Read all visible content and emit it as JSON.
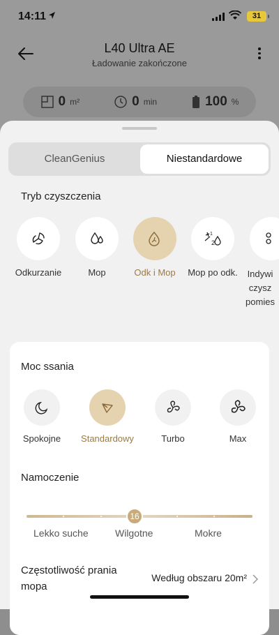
{
  "status_bar": {
    "time": "14:11",
    "battery": "31"
  },
  "header": {
    "title": "L40 Ultra AE",
    "subtitle": "Ładowanie zakończone"
  },
  "stats": [
    {
      "icon": "area-icon",
      "value": "0",
      "unit": "m²"
    },
    {
      "icon": "clock-icon",
      "value": "0",
      "unit": "min"
    },
    {
      "icon": "battery-icon",
      "value": "100",
      "unit": "%"
    }
  ],
  "tabs": {
    "left": "CleanGenius",
    "right": "Niestandardowe",
    "active": "right"
  },
  "cleaning_mode": {
    "title": "Tryb czyszczenia",
    "items": [
      {
        "label": "Odkurzanie",
        "selected": false
      },
      {
        "label": "Mop",
        "selected": false
      },
      {
        "label": "Odk i Mop",
        "selected": true
      },
      {
        "label": "Mop po odk.",
        "selected": false
      },
      {
        "label": "Indywidualne czyszczenie pomieszczeń",
        "selected": false
      }
    ],
    "partial_label_lines": [
      "Indywi",
      "czysz",
      "pomies"
    ]
  },
  "suction": {
    "title": "Moc ssania",
    "items": [
      {
        "label": "Spokojne",
        "selected": false
      },
      {
        "label": "Standardowy",
        "selected": true
      },
      {
        "label": "Turbo",
        "selected": false
      },
      {
        "label": "Max",
        "selected": false
      }
    ]
  },
  "moisture": {
    "title": "Namoczenie",
    "value": "16",
    "labels": [
      "Lekko suche",
      "Wilgotne",
      "Mokre"
    ],
    "level_fraction": 0.5
  },
  "mop_wash": {
    "label": "Częstotliwość prania mopa",
    "value": "Według obszaru 20m²"
  },
  "colors": {
    "accent": "#c9ab7b",
    "accent_text": "#9a7a48",
    "selected_bg": "#e5d3b0"
  }
}
